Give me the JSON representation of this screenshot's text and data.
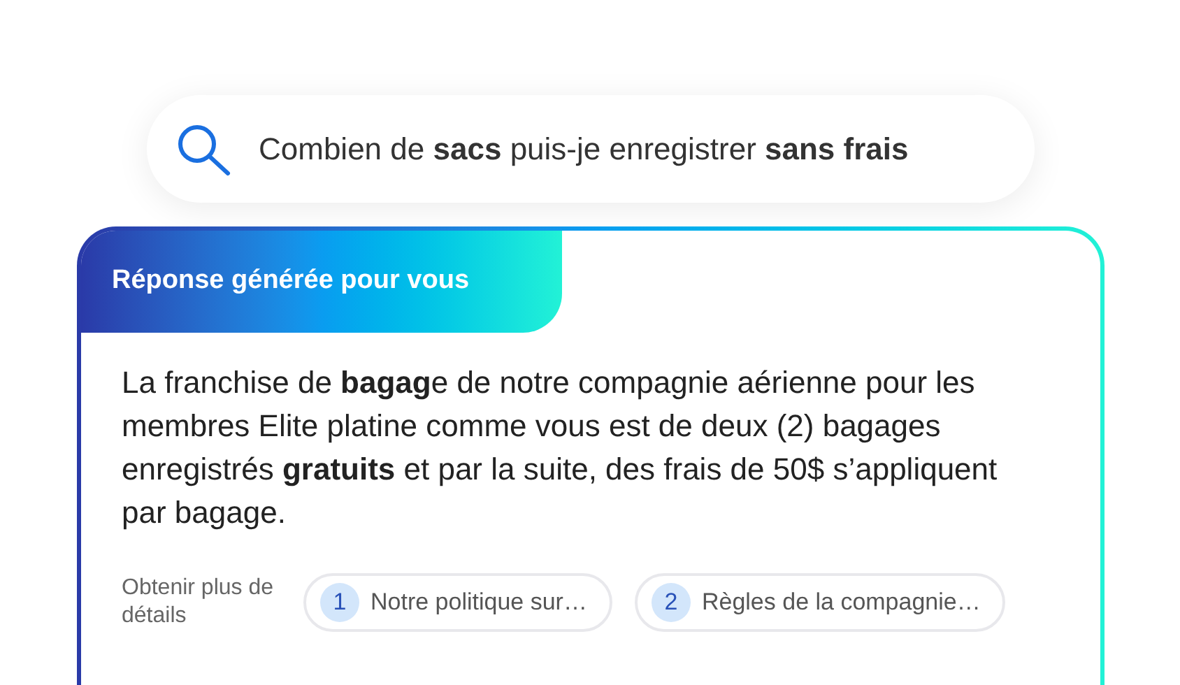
{
  "search": {
    "query": "Combien de **sacs** puis-je enregistrer **sans frais**"
  },
  "answer": {
    "header": "Réponse générée pour vous",
    "text": "La franchise de **bagag**e de notre compagnie aérienne pour les membres Elite platine comme vous est de deux (2) bagages enregistrés **gratuits** et par la suite, des frais de 50$ s’appliquent par bagage.",
    "details_label": "Obtenir plus de détails",
    "sources": [
      {
        "number": "1",
        "label": "Notre politique sur…"
      },
      {
        "number": "2",
        "label": "Règles de la compagnie…"
      }
    ]
  }
}
